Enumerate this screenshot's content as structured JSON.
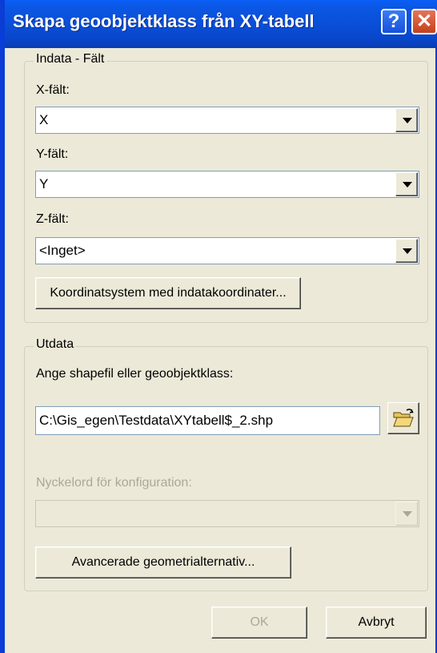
{
  "window": {
    "title": "Skapa geoobjektklass från XY-tabell",
    "help_glyph": "?",
    "close_glyph": "✕"
  },
  "indata": {
    "legend": "Indata - Fält",
    "x_label": "X-fält:",
    "x_value": "X",
    "y_label": "Y-fält:",
    "y_value": "Y",
    "z_label": "Z-fält:",
    "z_value": "<Inget>",
    "coord_button": "Koordinatsystem med indatakoordinater..."
  },
  "utdata": {
    "legend": "Utdata",
    "output_label": "Ange shapefil eller geoobjektklass:",
    "output_value": "C:\\Gis_egen\\Testdata\\XYtabell$_2.shp",
    "config_label": "Nyckelord för konfiguration:",
    "config_value": "",
    "advanced_button": "Avancerade geometrialternativ..."
  },
  "footer": {
    "ok_label": "OK",
    "cancel_label": "Avbryt"
  },
  "colors": {
    "titlebar": "#0a4fd8",
    "dialog": "#ece9d8",
    "disabled_text": "#aca899",
    "close": "#c4411d"
  }
}
